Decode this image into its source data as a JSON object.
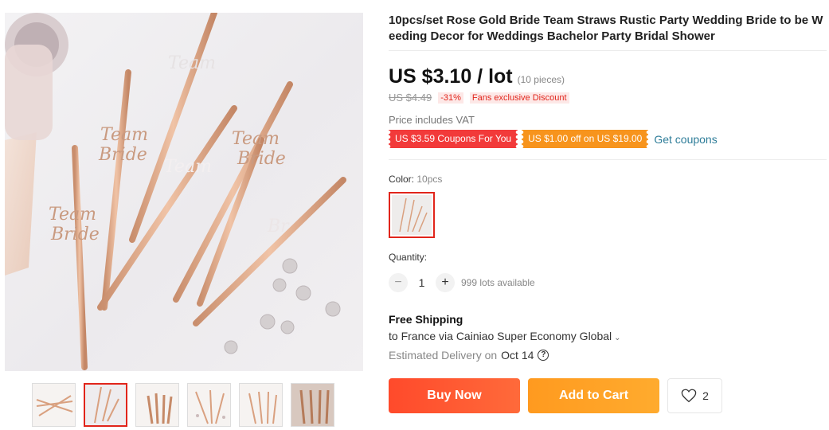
{
  "product": {
    "title": "10pcs/set Rose Gold Bride Team Straws Rustic Party Wedding Bride to be Weeding Decor for Weddings Bachelor Party Bridal Shower"
  },
  "price": {
    "current": "US $3.10 / lot",
    "pieces": "(10 pieces)",
    "original": "US $4.49",
    "discount": "-31%",
    "fans_tag": "Fans exclusive Discount",
    "vat": "Price includes VAT"
  },
  "coupons": {
    "coupon1": "US $3.59 Coupons For You",
    "coupon2": "US $1.00 off on US $19.00",
    "get_link": "Get coupons"
  },
  "color": {
    "label": "Color: ",
    "value": "10pcs"
  },
  "quantity": {
    "label": "Quantity:",
    "minus": "−",
    "value": "1",
    "plus": "+",
    "available": "999 lots available"
  },
  "shipping": {
    "title": "Free Shipping",
    "destination": "to France via Cainiao Super Economy Global",
    "chevron": "⌄",
    "delivery_label": "Estimated Delivery on",
    "delivery_date": "Oct 14",
    "help": "?"
  },
  "actions": {
    "buy_now": "Buy Now",
    "add_to_cart": "Add to Cart",
    "wishlist_count": "2"
  },
  "colors": {
    "accent_red": "#e1251b",
    "buy_orange_red": "#ff4a2b",
    "cart_orange": "#ff9a1f",
    "rose_gold": "#d9a07f"
  },
  "icons": {
    "wishlist": "heart-icon",
    "help": "question-icon",
    "dropdown": "chevron-down-icon"
  }
}
